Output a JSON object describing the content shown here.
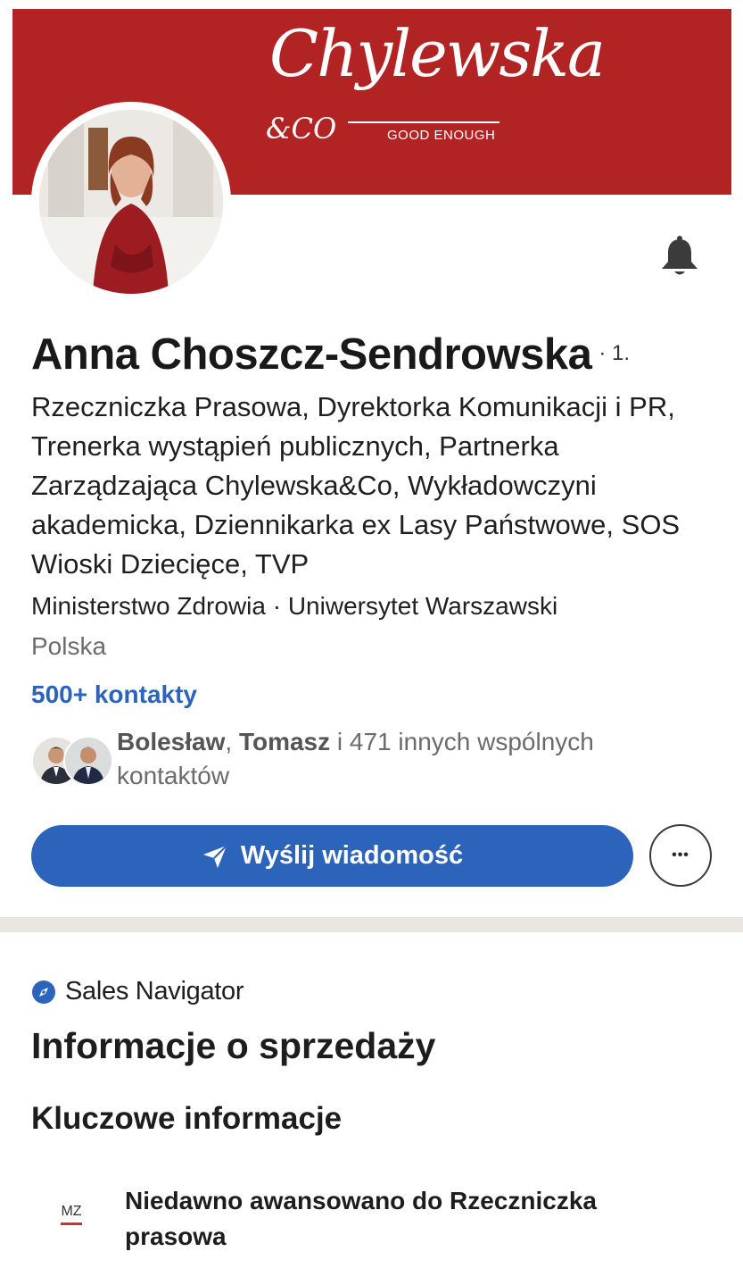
{
  "banner": {
    "brand_script": "Chylewska",
    "brand_co": "&CO",
    "brand_tagline": "GOOD ENOUGH",
    "background_color": "#b22324"
  },
  "profile": {
    "name": "Anna Choszcz-Sendrowska",
    "degree": "· 1.",
    "headline": "Rzeczniczka Prasowa, Dyrektorka Komunikacji i PR, Trenerka wystąpień publicznych, Partnerka Zarządzająca Chylewska&Co, Wykładowczyni akademicka, Dziennikarka ex Lasy Państwowe, SOS Wioski Dziecięce, TVP",
    "organizations": "Ministerstwo Zdrowia · Uniwersytet Warszawski",
    "location": "Polska",
    "connections": "500+ kontakty"
  },
  "mutual": {
    "name1": "Bolesław",
    "separator": ", ",
    "name2": "Tomasz",
    "rest": " i 471 innych wspólnych kontaktów"
  },
  "actions": {
    "message_label": "Wyślij wiadomość",
    "more_label": "•••"
  },
  "sales_navigator": {
    "label": "Sales Navigator",
    "section_title": "Informacje o sprzedaży",
    "key_info_title": "Kluczowe informacje",
    "insight_logo": "MZ",
    "insight_text": "Niedawno awansowano do Rzeczniczka prasowa"
  },
  "icons": {
    "bell": "bell-icon",
    "send": "send-icon",
    "compass": "compass-icon"
  },
  "colors": {
    "accent": "#2c64bc",
    "banner": "#b22324",
    "divider": "#e9e6e2"
  }
}
